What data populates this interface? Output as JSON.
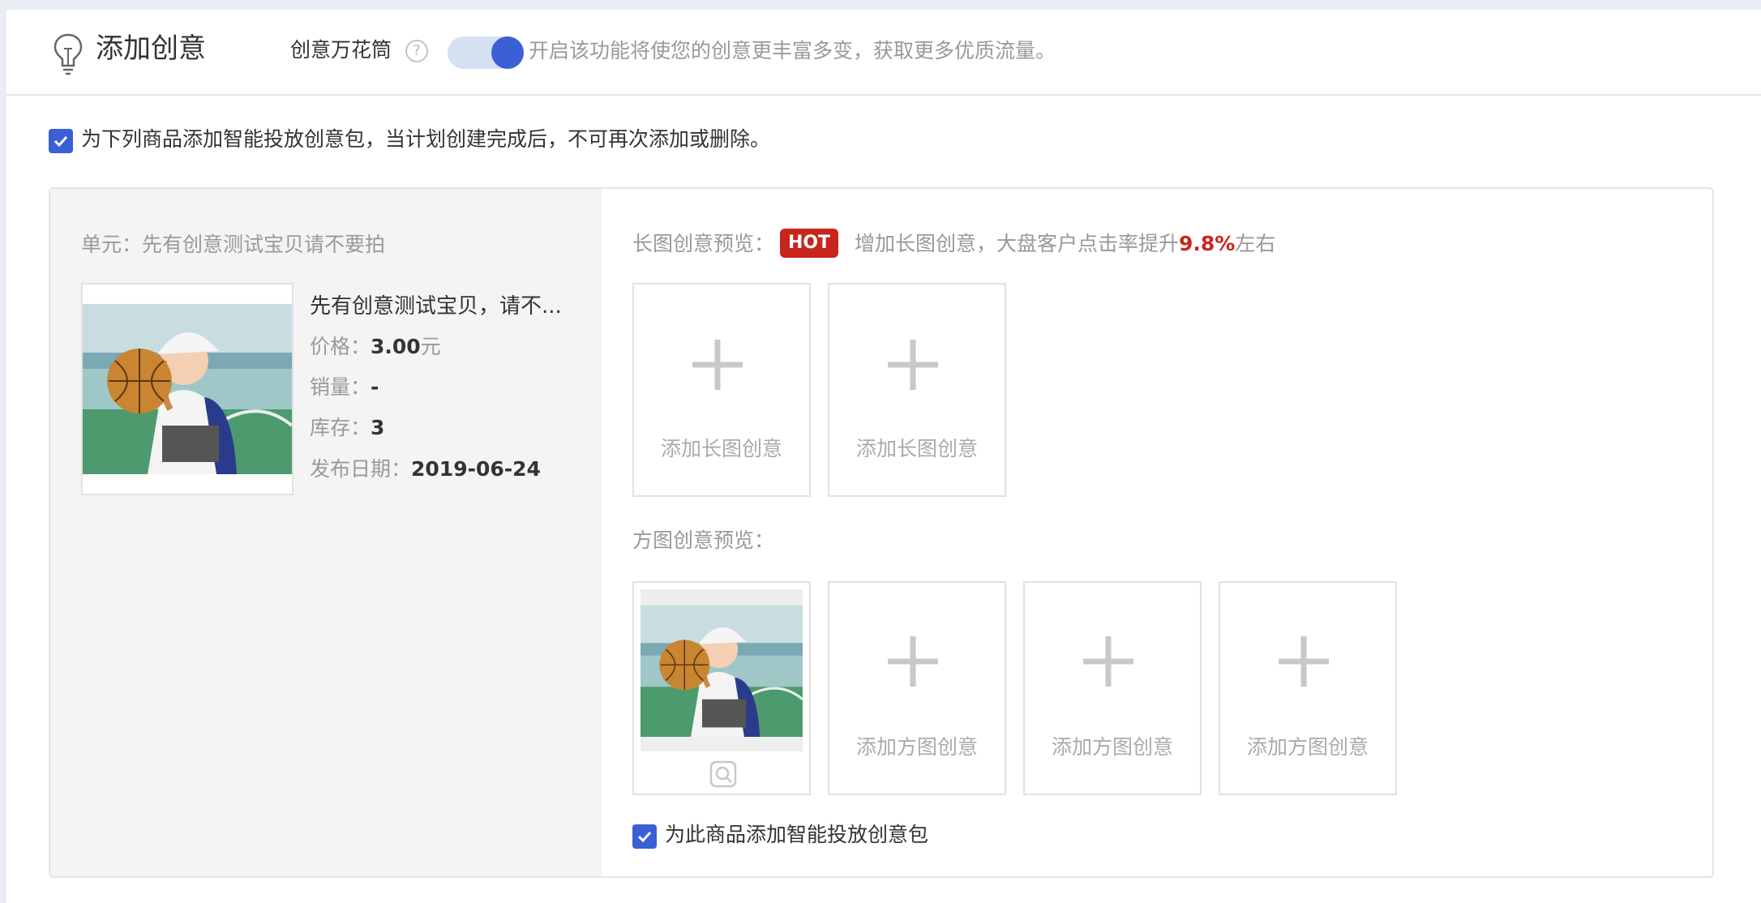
{
  "header": {
    "title": "添加创意",
    "icon": "lightbulb-icon",
    "kaleidoscope_label": "创意万花筒",
    "help_icon": "question-circle-icon",
    "help_glyph": "?",
    "toggle_on": true,
    "toggle_hint": "开启该功能将使您的创意更丰富多变，获取更多优质流量。"
  },
  "smart_package": {
    "checked": true,
    "label": "为下列商品添加智能投放创意包，当计划创建完成后，不可再次添加或删除。"
  },
  "unit": {
    "label": "单元：先有创意测试宝贝请不要拍"
  },
  "product": {
    "name": "先有创意测试宝贝，请不...",
    "price_label": "价格：",
    "price_value": "3.00",
    "price_unit": "元",
    "sales_label": "销量：",
    "sales_value": "-",
    "stock_label": "库存：",
    "stock_value": "3",
    "date_label": "发布日期：",
    "date_value": "2019-06-24"
  },
  "long_image": {
    "label": "长图创意预览：",
    "badge": "HOT",
    "hint_prefix": "增加长图创意，大盘客户点击率提升",
    "hint_pct": "9.8%",
    "hint_suffix": "左右",
    "slots": [
      {
        "label": "添加长图创意"
      },
      {
        "label": "添加长图创意"
      }
    ]
  },
  "square_image": {
    "label": "方图创意预览：",
    "preview_icon": "preview-eye-icon",
    "slots": [
      {
        "label": "添加方图创意"
      },
      {
        "label": "添加方图创意"
      },
      {
        "label": "添加方图创意"
      }
    ]
  },
  "item_package": {
    "checked": true,
    "label": "为此商品添加智能投放创意包"
  },
  "colors": {
    "accent": "#3b5fd6",
    "hot": "#c8261d",
    "panel_left_bg": "#f4f4f4"
  }
}
